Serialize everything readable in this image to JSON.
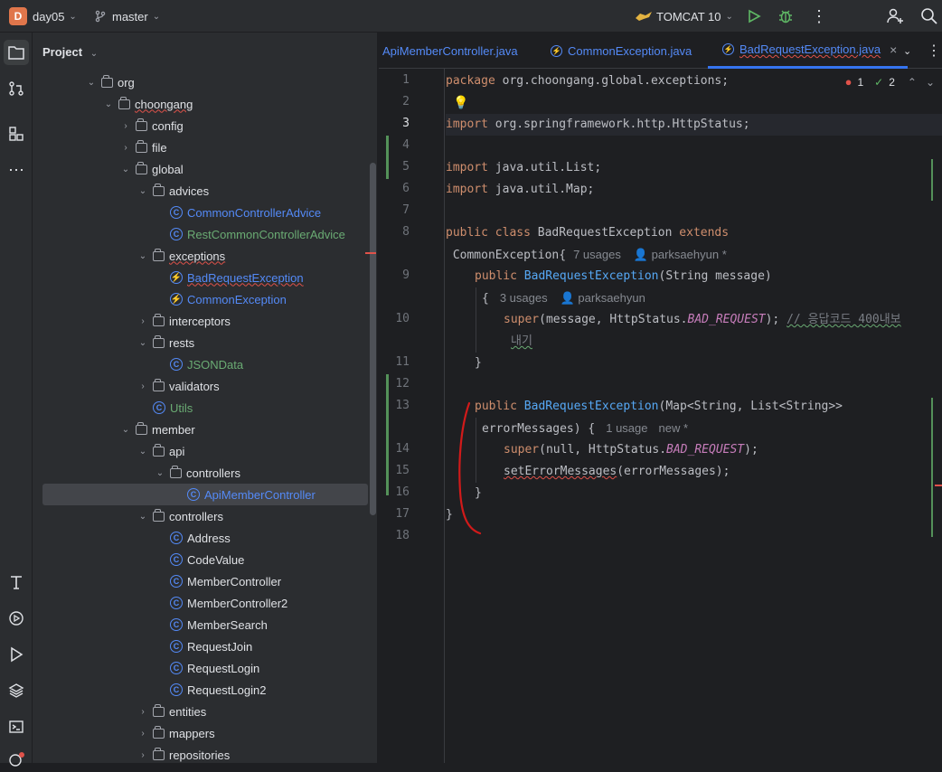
{
  "topbar": {
    "project_initial": "D",
    "project_name": "day05",
    "branch": "master",
    "run_config": "TOMCAT 10"
  },
  "project_panel": {
    "title": "Project",
    "tree": [
      {
        "label": "org",
        "type": "folder",
        "depth": 4,
        "expanded": true
      },
      {
        "label": "choongang",
        "type": "folder",
        "depth": 5,
        "expanded": true,
        "err": true
      },
      {
        "label": "config",
        "type": "folder",
        "depth": 6,
        "expanded": false
      },
      {
        "label": "file",
        "type": "folder",
        "depth": 6,
        "expanded": false
      },
      {
        "label": "global",
        "type": "folder",
        "depth": 6,
        "expanded": true
      },
      {
        "label": "advices",
        "type": "folder",
        "depth": 7,
        "expanded": true
      },
      {
        "label": "CommonControllerAdvice",
        "type": "class",
        "depth": 8,
        "color": "blue"
      },
      {
        "label": "RestCommonControllerAdvice",
        "type": "class",
        "depth": 8,
        "color": "green"
      },
      {
        "label": "exceptions",
        "type": "folder",
        "depth": 7,
        "expanded": true,
        "err": true
      },
      {
        "label": "BadRequestException",
        "type": "exception",
        "depth": 8,
        "color": "blue",
        "err": true
      },
      {
        "label": "CommonException",
        "type": "exception",
        "depth": 8,
        "color": "blue"
      },
      {
        "label": "interceptors",
        "type": "folder",
        "depth": 7,
        "expanded": false
      },
      {
        "label": "rests",
        "type": "folder",
        "depth": 7,
        "expanded": true
      },
      {
        "label": "JSONData",
        "type": "class",
        "depth": 8,
        "color": "green"
      },
      {
        "label": "validators",
        "type": "folder",
        "depth": 7,
        "expanded": false
      },
      {
        "label": "Utils",
        "type": "class",
        "depth": 7,
        "color": "green"
      },
      {
        "label": "member",
        "type": "folder",
        "depth": 6,
        "expanded": true
      },
      {
        "label": "api",
        "type": "folder",
        "depth": 7,
        "expanded": true
      },
      {
        "label": "controllers",
        "type": "folder",
        "depth": 8,
        "expanded": true
      },
      {
        "label": "ApiMemberController",
        "type": "class",
        "depth": 9,
        "color": "blue",
        "selected": true
      },
      {
        "label": "controllers",
        "type": "folder",
        "depth": 7,
        "expanded": true
      },
      {
        "label": "Address",
        "type": "class",
        "depth": 8,
        "color": "plain"
      },
      {
        "label": "CodeValue",
        "type": "class",
        "depth": 8,
        "color": "plain"
      },
      {
        "label": "MemberController",
        "type": "class",
        "depth": 8,
        "color": "plain"
      },
      {
        "label": "MemberController2",
        "type": "class",
        "depth": 8,
        "color": "plain"
      },
      {
        "label": "MemberSearch",
        "type": "class",
        "depth": 8,
        "color": "plain"
      },
      {
        "label": "RequestJoin",
        "type": "class",
        "depth": 8,
        "color": "plain"
      },
      {
        "label": "RequestLogin",
        "type": "class",
        "depth": 8,
        "color": "plain"
      },
      {
        "label": "RequestLogin2",
        "type": "class",
        "depth": 8,
        "color": "plain"
      },
      {
        "label": "entities",
        "type": "folder",
        "depth": 7,
        "expanded": false
      },
      {
        "label": "mappers",
        "type": "folder",
        "depth": 7,
        "expanded": false
      },
      {
        "label": "repositories",
        "type": "folder",
        "depth": 7,
        "expanded": false
      }
    ]
  },
  "tabs": [
    {
      "label": "ApiMemberController.java",
      "active": false
    },
    {
      "label": "CommonException.java",
      "active": false
    },
    {
      "label": "BadRequestException.java",
      "active": true
    }
  ],
  "inspections": {
    "errors": "1",
    "warnings": "2"
  },
  "code": {
    "line_numbers": [
      "1",
      "2",
      "3",
      "4",
      "5",
      "6",
      "7",
      "8",
      "",
      "9",
      "",
      "10",
      "",
      "11",
      "12",
      "13",
      "",
      "14",
      "15",
      "16",
      "17",
      "18"
    ],
    "l1": [
      "package",
      " org.choongang.global.exceptions;"
    ],
    "l3": [
      "import",
      " org.springframework.http.HttpStatus;"
    ],
    "l5": [
      "import",
      " java.util.List;"
    ],
    "l6": [
      "import",
      " java.util.Map;"
    ],
    "l8": [
      "public class",
      " BadRequestException ",
      "extends"
    ],
    "l8b": {
      "code": " CommonException{",
      "usages": "7 usages",
      "author": "parksaehyun *"
    },
    "l9": [
      "public",
      " BadRequestException",
      "(String message)"
    ],
    "l9b": {
      "code": "{",
      "usages": "3 usages",
      "author": "parksaehyun"
    },
    "l10": [
      "super",
      "(message, HttpStatus.",
      "BAD_REQUEST",
      "); ",
      "// 응답코드 400내보"
    ],
    "l10b": "내기",
    "l11": "}",
    "l13": [
      "public",
      " BadRequestException",
      "(Map<String, List<String>>"
    ],
    "l13b": {
      "code": "errorMessages) {",
      "usages": "1 usage",
      "author": "new *"
    },
    "l14": [
      "super",
      "(null, HttpStatus.",
      "BAD_REQUEST",
      ");"
    ],
    "l15": [
      "setErrorMessages",
      "(errorMessages);"
    ],
    "l16": "}",
    "l17": "}"
  }
}
